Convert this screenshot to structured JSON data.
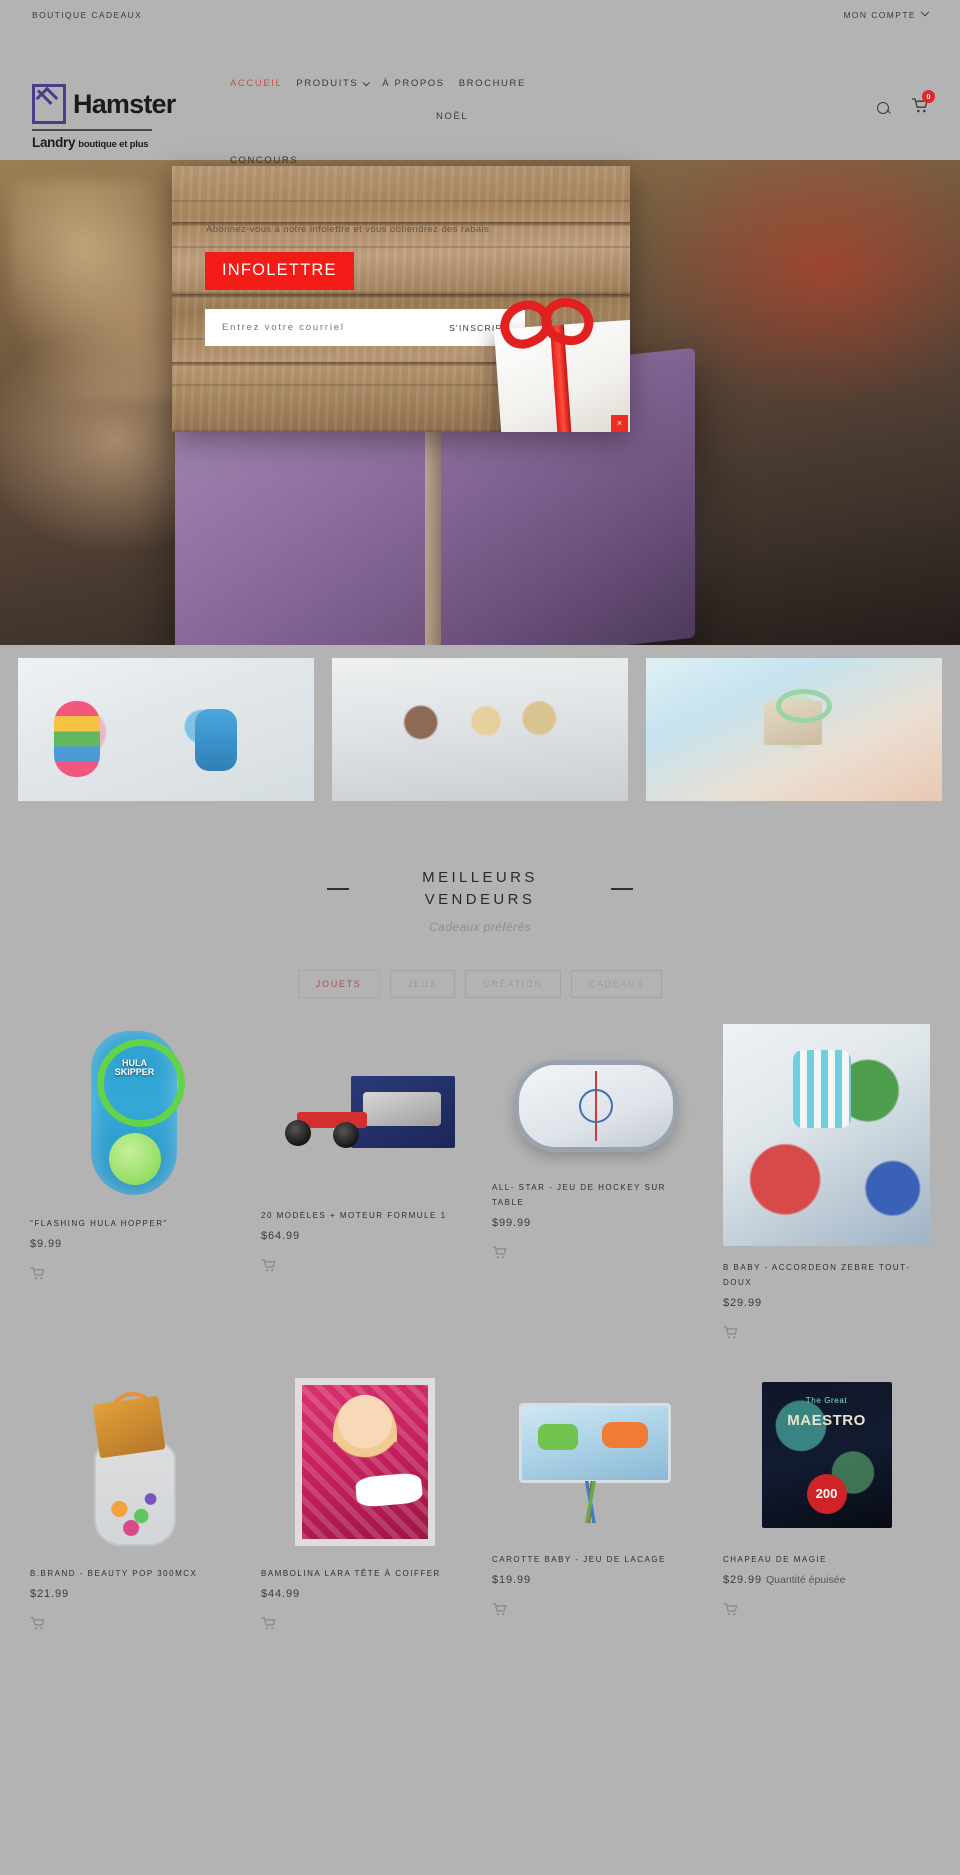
{
  "topbar": {
    "left_link": "BOUTIQUE CADEAUX",
    "account_link": "MON COMPTE"
  },
  "logo": {
    "word": "Hamster",
    "sub_brand": "Landry",
    "sub_tagline": "boutique et plus"
  },
  "nav": {
    "items": [
      {
        "label": "ACCUEIL",
        "active": true,
        "caret": false
      },
      {
        "label": "PRODUITS",
        "active": false,
        "caret": true
      },
      {
        "label": "À PROPOS",
        "active": false,
        "caret": false
      },
      {
        "label": "BROCHURE",
        "active": false,
        "caret": false
      },
      {
        "label": "NOËL",
        "active": false,
        "caret": false
      },
      {
        "label": "CONCOURS",
        "active": false,
        "caret": false
      }
    ],
    "cart_count": "0"
  },
  "popup": {
    "badge": "INFOLETTRE",
    "tagline": "Abonnez-vous à notre infolettre et vous obtiendrez des rabais",
    "email_placeholder": "Entrez votre courriel",
    "email_value": "",
    "submit_label": "S'INSCRIRE",
    "close_label": "×",
    "accent_color": "#f21b16"
  },
  "section": {
    "title": "MEILLEURS VENDEURS",
    "subtitle": "Cadeaux préférés"
  },
  "tabs": [
    {
      "label": "JOUETS",
      "active": true
    },
    {
      "label": "JEUX",
      "active": false
    },
    {
      "label": "CRÉATION",
      "active": false
    },
    {
      "label": "CADEAUX",
      "active": false
    }
  ],
  "products": [
    {
      "title": "\"FLASHING HULA HOPPER\"",
      "price": "$9.99",
      "stock": "",
      "image": "hula-skipper-toy"
    },
    {
      "title": "20 MODÈLES + MOTEUR FORMULE 1",
      "price": "$64.99",
      "stock": "",
      "image": "meccano-formula-1"
    },
    {
      "title": "ALL- STAR - JEU DE HOCKEY SUR TABLE",
      "price": "$99.99",
      "stock": "",
      "image": "table-hockey-game"
    },
    {
      "title": "B BABY - ACCORDEON ZEBRE TOUT-DOUX",
      "price": "$29.99",
      "stock": "",
      "image": "baby-playmat"
    },
    {
      "title": "B.BRAND - BEAUTY POP 300MCX",
      "price": "$21.99",
      "stock": "",
      "image": "beauty-pop-jar"
    },
    {
      "title": "BAMBOLINA LARA TÊTE À COIFFER",
      "price": "$44.99",
      "stock": "",
      "image": "bambolina-lara-doll"
    },
    {
      "title": "CAROTTE BABY - JEU DE LACAGE",
      "price": "$19.99",
      "stock": "",
      "image": "carotte-lacing-game"
    },
    {
      "title": "CHAPEAU DE MAGIE",
      "price": "$29.99",
      "stock": "Quantité épuisée",
      "image": "magic-hat-box"
    }
  ],
  "product_art": {
    "hula_label": "HULA SKIPPER",
    "magie_top": "The Great",
    "magie_name": "MAESTRO",
    "magie_count": "200"
  }
}
